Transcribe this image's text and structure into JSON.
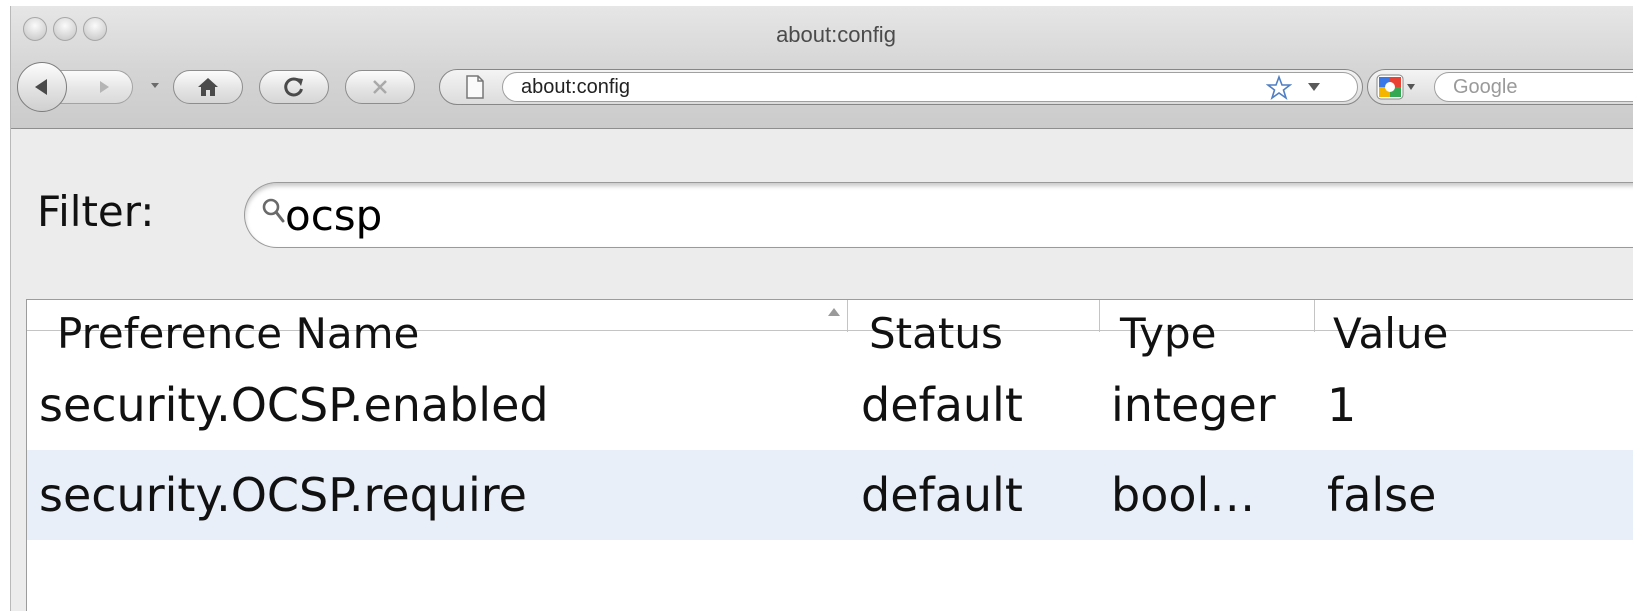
{
  "window": {
    "title": "about:config",
    "traffic_lights": [
      "close",
      "minimize",
      "zoom"
    ]
  },
  "toolbar": {
    "buttons": [
      "back-icon",
      "forward-icon",
      "history-dropdown-icon",
      "home-icon",
      "reload-icon",
      "stop-icon"
    ],
    "url": "about:config",
    "page_icon": "document-icon",
    "bookmark_icon": "star-icon",
    "search_engine_icon": "google-icon",
    "search_placeholder": "Google"
  },
  "filter": {
    "label": "Filter:",
    "value": "ocsp",
    "icon": "search-icon"
  },
  "table": {
    "sort_column": "Preference Name",
    "sort_direction": "ascending",
    "columns": [
      {
        "key": "name",
        "label": "Preference Name"
      },
      {
        "key": "status",
        "label": "Status"
      },
      {
        "key": "type",
        "label": "Type"
      },
      {
        "key": "value",
        "label": "Value"
      }
    ],
    "rows": [
      {
        "name": "security.OCSP.enabled",
        "status": "default",
        "type": "integer",
        "value": "1",
        "selected": false
      },
      {
        "name": "security.OCSP.require",
        "status": "default",
        "type": "bool…",
        "value": "false",
        "selected": true
      }
    ]
  },
  "colors": {
    "selected_row": "#e8eff8",
    "chrome_background": "#d4d4d4",
    "content_background": "#ececec"
  }
}
